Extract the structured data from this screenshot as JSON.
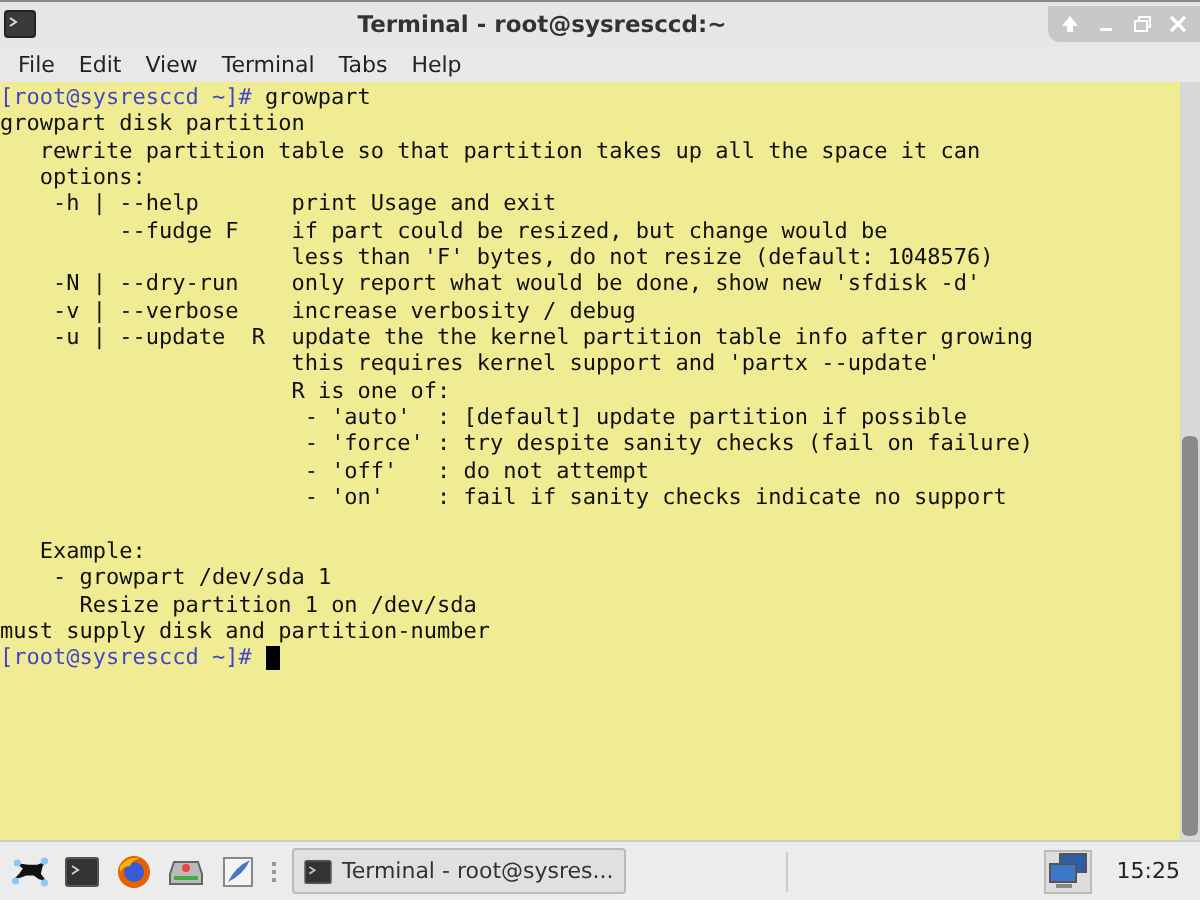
{
  "window": {
    "title": "Terminal - root@sysresccd:~"
  },
  "menu": [
    "File",
    "Edit",
    "View",
    "Terminal",
    "Tabs",
    "Help"
  ],
  "terminal": {
    "lines": [
      {
        "kind": "prompt",
        "prompt": "[root@sysresccd ~]#",
        "command": "growpart"
      },
      {
        "kind": "output",
        "text": "growpart disk partition"
      },
      {
        "kind": "output",
        "text": "   rewrite partition table so that partition takes up all the space it can"
      },
      {
        "kind": "output",
        "text": "   options:"
      },
      {
        "kind": "output",
        "text": "    -h | --help       print Usage and exit"
      },
      {
        "kind": "output",
        "text": "         --fudge F    if part could be resized, but change would be"
      },
      {
        "kind": "output",
        "text": "                      less than 'F' bytes, do not resize (default: 1048576)"
      },
      {
        "kind": "output",
        "text": "    -N | --dry-run    only report what would be done, show new 'sfdisk -d'"
      },
      {
        "kind": "output",
        "text": "    -v | --verbose    increase verbosity / debug"
      },
      {
        "kind": "output",
        "text": "    -u | --update  R  update the the kernel partition table info after growing"
      },
      {
        "kind": "output",
        "text": "                      this requires kernel support and 'partx --update'"
      },
      {
        "kind": "output",
        "text": "                      R is one of:"
      },
      {
        "kind": "output",
        "text": "                       - 'auto'  : [default] update partition if possible"
      },
      {
        "kind": "output",
        "text": "                       - 'force' : try despite sanity checks (fail on failure)"
      },
      {
        "kind": "output",
        "text": "                       - 'off'   : do not attempt"
      },
      {
        "kind": "output",
        "text": "                       - 'on'    : fail if sanity checks indicate no support"
      },
      {
        "kind": "blank"
      },
      {
        "kind": "output",
        "text": "   Example:"
      },
      {
        "kind": "output",
        "text": "    - growpart /dev/sda 1"
      },
      {
        "kind": "output",
        "text": "      Resize partition 1 on /dev/sda"
      },
      {
        "kind": "output",
        "text": "must supply disk and partition-number"
      },
      {
        "kind": "prompt",
        "prompt": "[root@sysresccd ~]#",
        "cursor": true
      }
    ]
  },
  "taskbar": {
    "task": "Terminal - root@sysres...",
    "clock": "15:25"
  }
}
